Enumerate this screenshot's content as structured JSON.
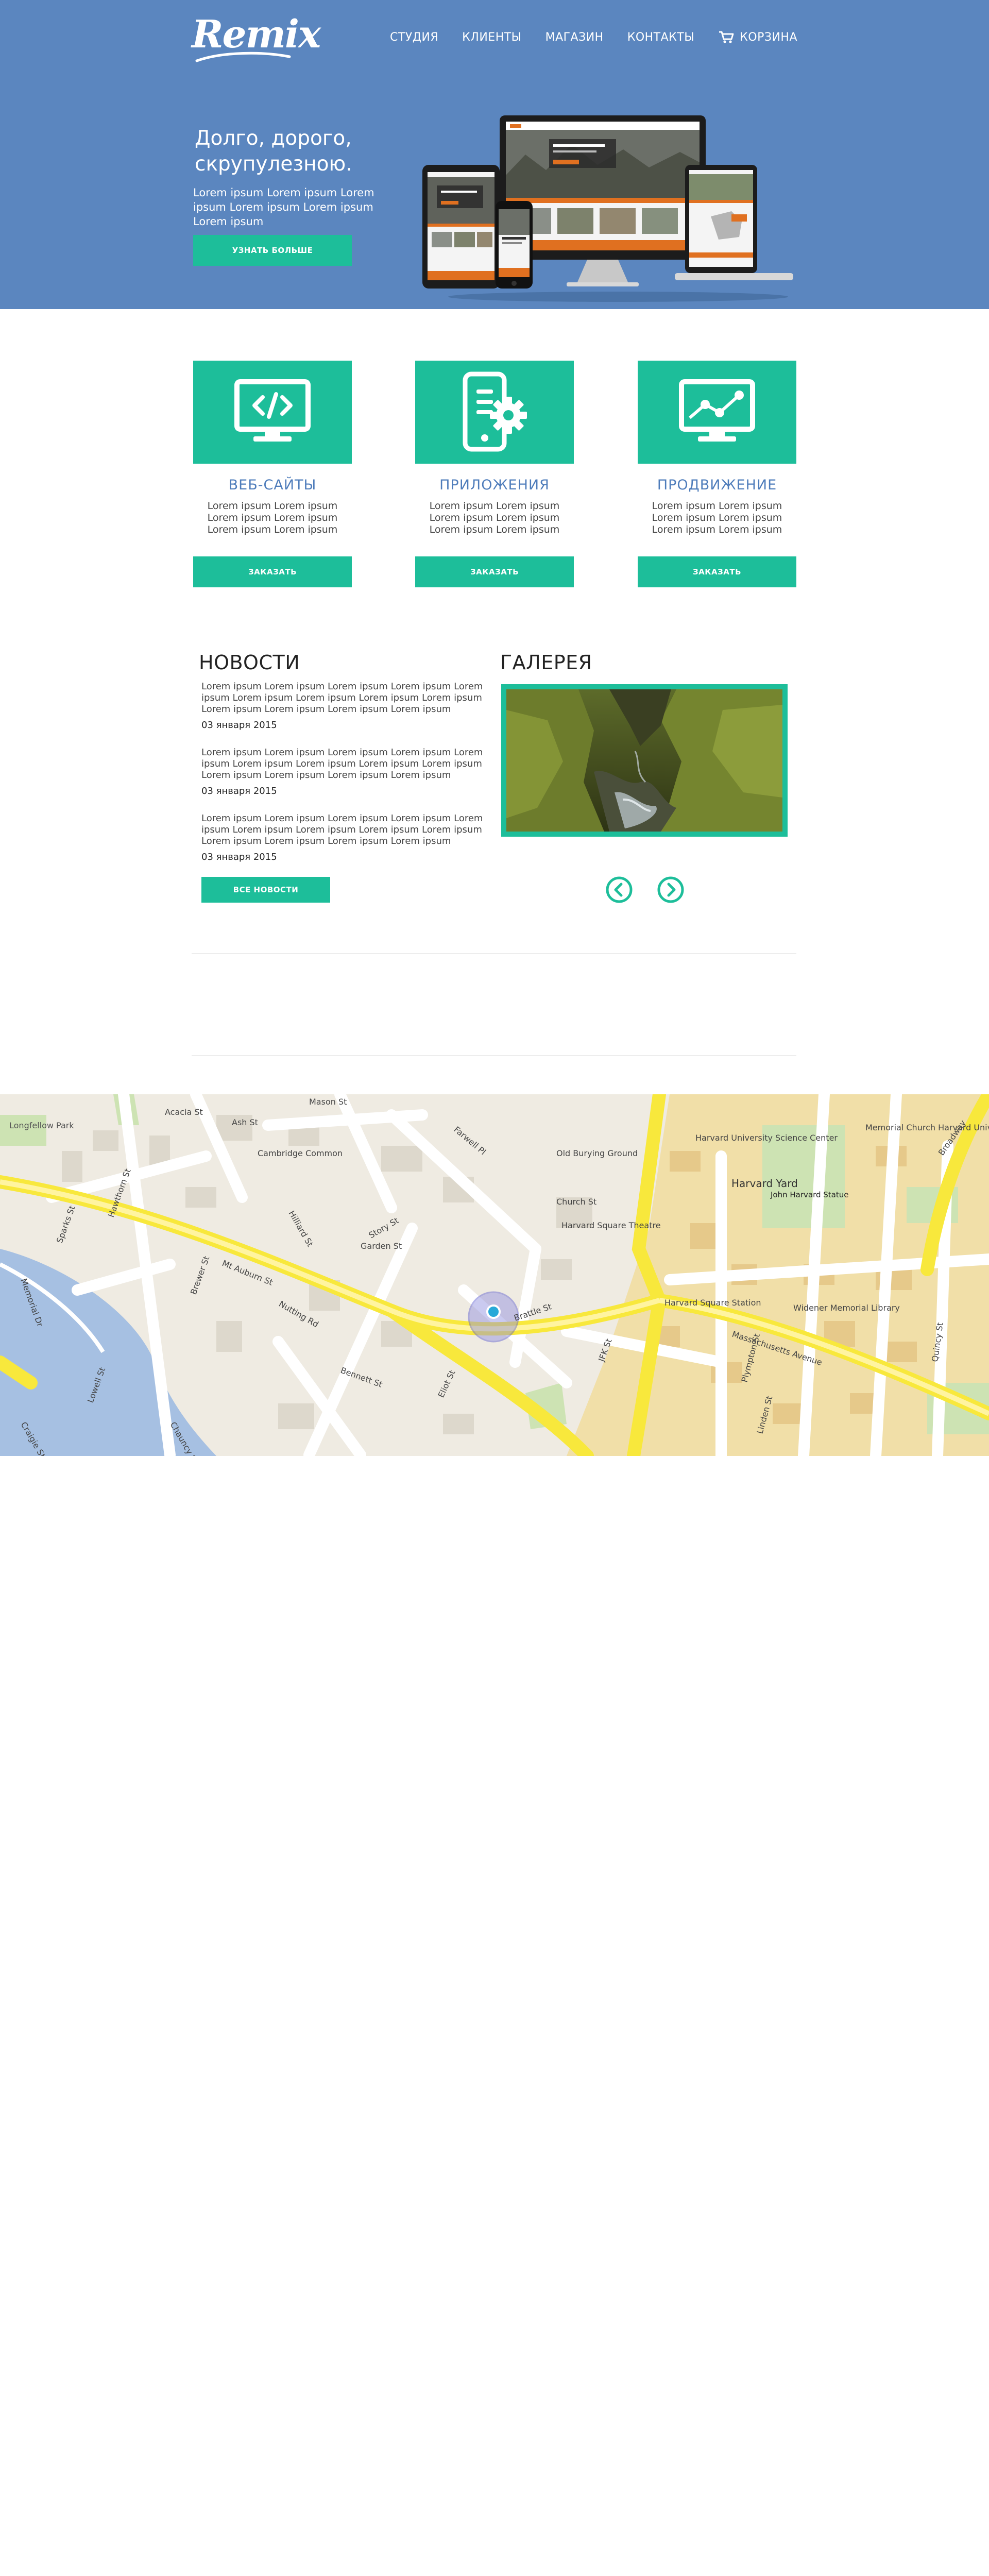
{
  "header": {
    "logo_text": "Remix",
    "nav": [
      {
        "label": "СТУДИЯ"
      },
      {
        "label": "КЛИЕНТЫ"
      },
      {
        "label": "МАГАЗИН"
      },
      {
        "label": "КОНТАКТЫ"
      },
      {
        "label": "КОРЗИНА",
        "icon": "cart-icon"
      }
    ]
  },
  "hero": {
    "title": "Долго, дорого, скрупулезною.",
    "text": "Lorem ipsum Lorem ipsum Lorem ipsum Lorem ipsum Lorem ipsum Lorem ipsum",
    "button": "УЗНАТЬ БОЛЬШЕ",
    "image": "devices-mockup"
  },
  "services": [
    {
      "icon": "code-monitor-icon",
      "title": "ВЕБ-САЙТЫ",
      "text": "Lorem ipsum Lorem ipsum Lorem ipsum Lorem ipsum Lorem ipsum Lorem ipsum",
      "button": "ЗАКАЗАТЬ"
    },
    {
      "icon": "phone-gear-icon",
      "title": "ПРИЛОЖЕНИЯ",
      "text": "Lorem ipsum Lorem ipsum Lorem ipsum Lorem ipsum Lorem ipsum Lorem ipsum",
      "button": "ЗАКАЗАТЬ"
    },
    {
      "icon": "analytics-monitor-icon",
      "title": "ПРОДВИЖЕНИЕ",
      "text": "Lorem ipsum Lorem ipsum Lorem ipsum Lorem ipsum Lorem ipsum Lorem ipsum",
      "button": "ЗАКАЗАТЬ"
    }
  ],
  "news": {
    "title": "НОВОСТИ",
    "items": [
      {
        "text": "Lorem ipsum Lorem ipsum Lorem ipsum Lorem ipsum Lorem ipsum Lorem ipsum Lorem ipsum Lorem ipsum Lorem ipsum Lorem ipsum Lorem ipsum Lorem ipsum Lorem ipsum",
        "date": "03 января 2015"
      },
      {
        "text": "Lorem ipsum Lorem ipsum Lorem ipsum Lorem ipsum Lorem ipsum Lorem ipsum Lorem ipsum Lorem ipsum Lorem ipsum Lorem ipsum Lorem ipsum Lorem ipsum Lorem ipsum",
        "date": "03 января 2015"
      },
      {
        "text": "Lorem ipsum Lorem ipsum Lorem ipsum Lorem ipsum Lorem ipsum Lorem ipsum Lorem ipsum Lorem ipsum Lorem ipsum Lorem ipsum Lorem ipsum Lorem ipsum Lorem ipsum",
        "date": "03 января 2015"
      }
    ],
    "button": "ВСЕ НОВОСТИ"
  },
  "gallery": {
    "title": "ГАЛЕРЕЯ",
    "image": "canyon-photo"
  },
  "map": {
    "labels": [
      "Longfellow Park",
      "Mt Auburn St",
      "Memorial Dr",
      "Brattle St",
      "Harvard Yard",
      "John Harvard Statue",
      "Massachusetts Avenue",
      "Old Burying Ground",
      "Church St",
      "Harvard Square Station",
      "Harvard Square Theatre",
      "Widener Memorial Library",
      "Bennett St",
      "Eliot St",
      "JFK St",
      "Quincy St",
      "Broadway",
      "Harvard University Science Center",
      "Memorial Church Harvard University",
      "Plympton St",
      "Linden St",
      "Garden St",
      "Acacia St",
      "Ash St",
      "Mason St",
      "Story St",
      "Brewer St",
      "Hilliard St",
      "Nutting Rd",
      "Farwell Pl",
      "Cambridge Common",
      "Sparks St",
      "Hawthorn St",
      "Lowell St",
      "Chauncy St",
      "Craigie St"
    ],
    "accent": "#fff36b"
  },
  "colors": {
    "brand_blue": "#5b86bf",
    "accent_green": "#1dbe9a",
    "title_blue": "#4f7dbb"
  }
}
